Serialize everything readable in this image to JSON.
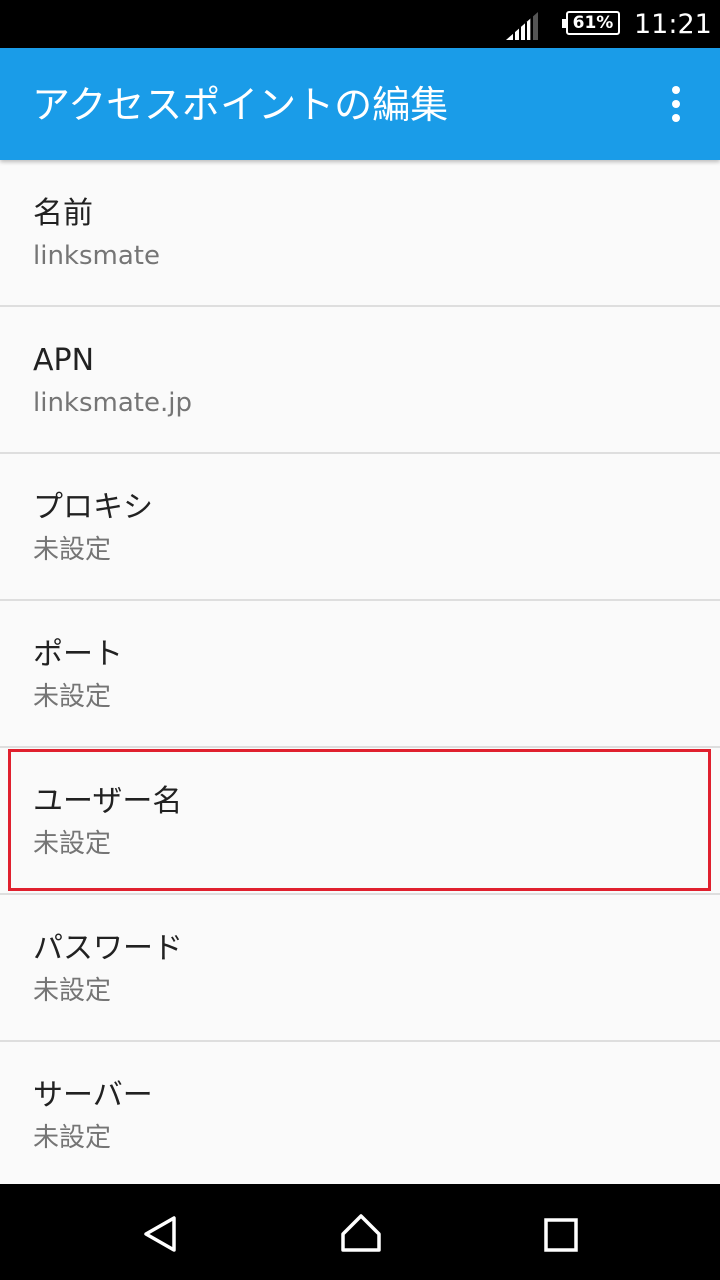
{
  "status_bar": {
    "battery": "61%",
    "time": "11:21"
  },
  "header": {
    "title": "アクセスポイントの編集",
    "overflow_icon": "more-vert-icon"
  },
  "items": [
    {
      "title": "名前",
      "value": "linksmate"
    },
    {
      "title": "APN",
      "value": "linksmate.jp"
    },
    {
      "title": "プロキシ",
      "value": "未設定"
    },
    {
      "title": "ポート",
      "value": "未設定"
    },
    {
      "title": "ユーザー名",
      "value": "未設定",
      "highlighted": true
    },
    {
      "title": "パスワード",
      "value": "未設定"
    },
    {
      "title": "サーバー",
      "value": "未設定"
    }
  ],
  "nav_bar": {
    "back_icon": "back-triangle-icon",
    "home_icon": "home-icon",
    "recents_icon": "recents-square-icon"
  },
  "colors": {
    "app_bar": "#1a9ce8",
    "highlight_border": "#e0202e",
    "background": "#fafafa"
  }
}
